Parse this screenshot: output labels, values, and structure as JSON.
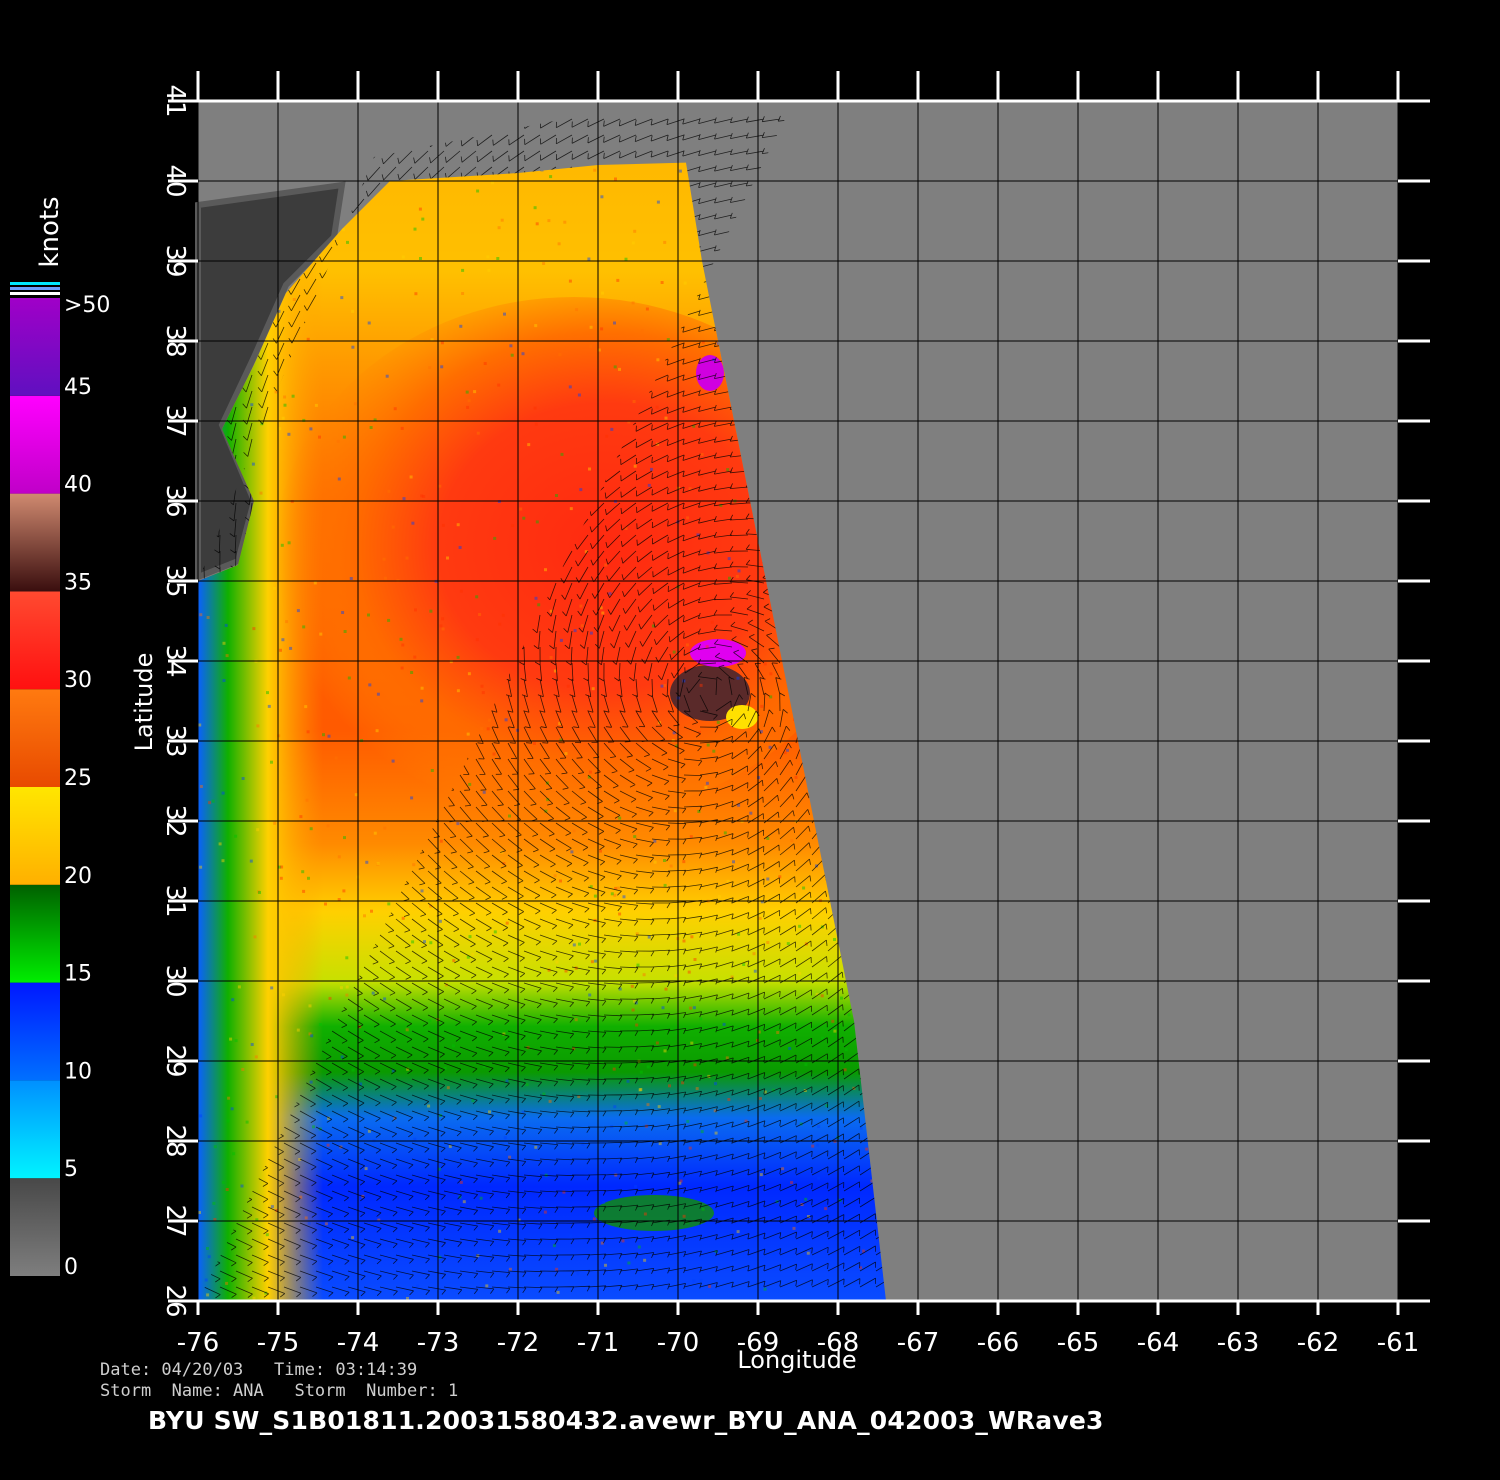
{
  "colorbar": {
    "unit_label": "knots",
    "ticks": [
      {
        "label": "0",
        "value": 0
      },
      {
        "label": "5",
        "value": 5
      },
      {
        "label": "10",
        "value": 10
      },
      {
        "label": "15",
        "value": 15
      },
      {
        "label": "20",
        "value": 20
      },
      {
        "label": "25",
        "value": 25
      },
      {
        "label": "30",
        "value": 30
      },
      {
        "label": "35",
        "value": 35
      },
      {
        "label": "40",
        "value": 40
      },
      {
        "label": "45",
        "value": 45
      },
      {
        "label": ">50",
        "value": 50
      }
    ],
    "bands": [
      {
        "from": 0,
        "to": 5,
        "top": "#484848",
        "bottom": "#7e7e7e"
      },
      {
        "from": 5,
        "to": 10,
        "top": "#0090ff",
        "bottom": "#00f4ff"
      },
      {
        "from": 10,
        "to": 15,
        "top": "#0018ff",
        "bottom": "#0070ff"
      },
      {
        "from": 15,
        "to": 20,
        "top": "#006000",
        "bottom": "#00ee00"
      },
      {
        "from": 20,
        "to": 25,
        "top": "#ffe600",
        "bottom": "#ffb000"
      },
      {
        "from": 25,
        "to": 30,
        "top": "#ff7a10",
        "bottom": "#e84a00"
      },
      {
        "from": 30,
        "to": 35,
        "top": "#ff4a30",
        "bottom": "#ff1010"
      },
      {
        "from": 35,
        "to": 40,
        "top": "#d08a70",
        "bottom": "#3a0e0e"
      },
      {
        "from": 40,
        "to": 45,
        "top": "#ff00ff",
        "bottom": "#c000c8"
      },
      {
        "from": 45,
        "to": 50,
        "top": "#a000c8",
        "bottom": "#6010c0"
      }
    ]
  },
  "map": {
    "type": "heatmap",
    "xlabel": "Longitude",
    "ylabel": "Latitude",
    "lon_range": [
      -76,
      -61
    ],
    "lat_range": [
      26,
      41
    ],
    "lon_ticks": [
      "-76",
      "-75",
      "-74",
      "-73",
      "-72",
      "-71",
      "-70",
      "-69",
      "-68",
      "-67",
      "-66",
      "-65",
      "-64",
      "-63",
      "-62",
      "-61"
    ],
    "lat_ticks": [
      "26",
      "27",
      "28",
      "29",
      "30",
      "31",
      "32",
      "33",
      "34",
      "35",
      "36",
      "37",
      "38",
      "39",
      "40",
      "41"
    ],
    "grid": true,
    "background_color": "#7f7f7f",
    "swath_polygon_lonlat": [
      [
        -76,
        35.0
      ],
      [
        -75.5,
        35.2
      ],
      [
        -75.3,
        36.0
      ],
      [
        -75.7,
        36.9
      ],
      [
        -75.3,
        37.7
      ],
      [
        -74.9,
        38.6
      ],
      [
        -74.2,
        39.4
      ],
      [
        -73.6,
        40.0
      ],
      [
        -72.0,
        40.1
      ],
      [
        -71.0,
        40.2
      ],
      [
        -69.9,
        40.23
      ],
      [
        -69.7,
        39.0
      ],
      [
        -69.3,
        37.0
      ],
      [
        -68.8,
        34.5
      ],
      [
        -68.4,
        32.5
      ],
      [
        -67.8,
        29.5
      ],
      [
        -67.4,
        26.0
      ],
      [
        -76,
        26.0
      ]
    ],
    "land_polygon_lonlat": [
      [
        -76,
        39.7
      ],
      [
        -74.2,
        39.95
      ],
      [
        -74.3,
        39.3
      ],
      [
        -74.9,
        38.7
      ],
      [
        -75.3,
        37.8
      ],
      [
        -75.7,
        36.95
      ],
      [
        -75.3,
        36.0
      ],
      [
        -75.5,
        35.25
      ],
      [
        -76,
        35.05
      ]
    ],
    "wind_speed_zones": [
      {
        "band_knots": "10-15",
        "lat_max": 29.2
      },
      {
        "band_knots": "15-20",
        "lat_min": 29.2,
        "lat_max": 30.6
      },
      {
        "band_knots": "20-25",
        "lat_min": 30.6,
        "lat_max": 32.0
      },
      {
        "band_knots": "25-30",
        "lat_min": 32.0,
        "lat_max": 37.5
      },
      {
        "band_knots": "30-35",
        "note": "core north of the storm center"
      },
      {
        "band_knots": "40-45",
        "note": "patches near 34N 69W and 37.5N 69.5W"
      }
    ]
  },
  "meta": {
    "date_line": "Date: 04/20/03   Time: 03:14:39",
    "storm_line": "Storm  Name: ANA   Storm  Number: 1",
    "file_title": "BYU  SW_S1B01811.20031580432.avewr_BYU_ANA_042003_WRave3"
  }
}
